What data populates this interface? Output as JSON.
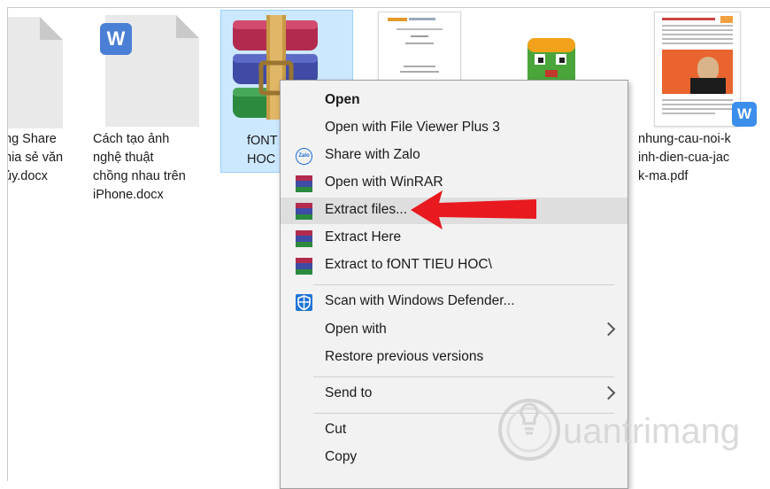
{
  "files": [
    {
      "id": "file1",
      "label_lines": [
        "ng Share",
        "nia sẻ văn",
        "ủy.docx"
      ]
    },
    {
      "id": "file2",
      "label_lines": [
        "Cách tạo ảnh",
        "nghệ thuật",
        "chồng nhau trên",
        "iPhone.docx"
      ],
      "badge": "W"
    },
    {
      "id": "file3",
      "label_lines": [
        "fONT",
        "HOC"
      ]
    },
    {
      "id": "file6",
      "label_lines": [
        "nhung-cau-noi-k",
        "inh-dien-cua-jac",
        "k-ma.pdf"
      ],
      "badge": "W"
    }
  ],
  "menu": {
    "items": [
      {
        "label": "Open",
        "bold": true,
        "icon": ""
      },
      {
        "label": "Open with File Viewer Plus 3",
        "icon": ""
      },
      {
        "label": "Share with Zalo",
        "icon": "zalo-icon"
      },
      {
        "label": "Open with WinRAR",
        "icon": "winrar-icon"
      },
      {
        "label": "Extract files...",
        "icon": "winrar-icon",
        "highlighted": true
      },
      {
        "label": "Extract Here",
        "icon": "winrar-icon"
      },
      {
        "label": "Extract to fONT TIEU HOC\\",
        "icon": "winrar-icon"
      },
      {
        "label": "Scan with Windows Defender...",
        "icon": "defender-icon"
      },
      {
        "label": "Open with",
        "submenu": true
      },
      {
        "label": "Restore previous versions"
      },
      {
        "label": "Send to",
        "submenu": true
      },
      {
        "label": "Cut"
      },
      {
        "label": "Copy"
      }
    ],
    "zalo_text": "Zalo"
  },
  "annotation": {
    "arrow_color": "#e8191f"
  },
  "colors": {
    "selection": "#cce8ff",
    "wps_blue": "#4a7fd6",
    "menu_bg": "#f2f2f2"
  },
  "watermark": {
    "text": "uantrimang"
  }
}
